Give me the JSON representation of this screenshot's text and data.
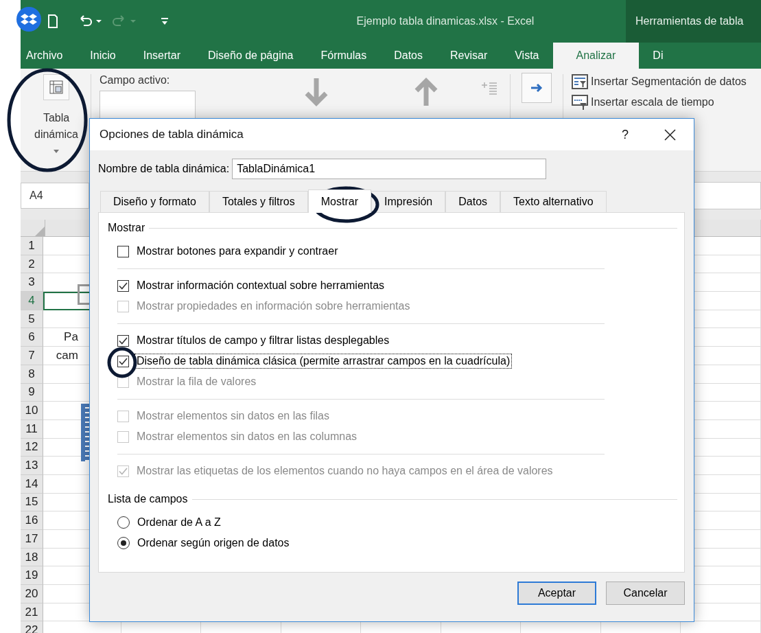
{
  "title_bar": {
    "file_title": "Ejemplo tabla dinamicas.xlsx - Excel",
    "context_title": "Herramientas de tabla"
  },
  "ribbon_tabs": [
    {
      "label": "Archivo",
      "selected": false
    },
    {
      "label": "Inicio",
      "selected": false
    },
    {
      "label": "Insertar",
      "selected": false
    },
    {
      "label": "Diseño de página",
      "selected": false
    },
    {
      "label": "Fórmulas",
      "selected": false
    },
    {
      "label": "Datos",
      "selected": false
    },
    {
      "label": "Revisar",
      "selected": false
    },
    {
      "label": "Vista",
      "selected": false
    },
    {
      "label": "Analizar",
      "selected": true
    },
    {
      "label": "Di",
      "selected": false
    }
  ],
  "ribbon": {
    "pivot_button": "Tabla dinámica",
    "active_field_label": "Campo activo:",
    "commands": [
      "Insertar Segmentación de datos",
      "Insertar escala de tiempo"
    ]
  },
  "name_box": "A4",
  "sheet": {
    "rows": [
      {
        "header": "1",
        "selected": false
      },
      {
        "header": "2",
        "selected": false
      },
      {
        "header": "3",
        "selected": false
      },
      {
        "header": "4",
        "selected": true
      },
      {
        "header": "5",
        "selected": false
      },
      {
        "header": "6",
        "selected": false,
        "cell_a": "Pa"
      },
      {
        "header": "7",
        "selected": false,
        "cell_a": "cam"
      },
      {
        "header": "8",
        "selected": false
      },
      {
        "header": "9",
        "selected": false
      },
      {
        "header": "10",
        "selected": false
      },
      {
        "header": "11",
        "selected": false
      },
      {
        "header": "12",
        "selected": false
      },
      {
        "header": "13",
        "selected": false
      },
      {
        "header": "14",
        "selected": false
      },
      {
        "header": "15",
        "selected": false
      },
      {
        "header": "16",
        "selected": false
      },
      {
        "header": "17",
        "selected": false
      },
      {
        "header": "18",
        "selected": false
      },
      {
        "header": "19",
        "selected": false
      },
      {
        "header": "20",
        "selected": false
      },
      {
        "header": "21",
        "selected": false
      },
      {
        "header": "22",
        "selected": false
      }
    ]
  },
  "dialog": {
    "title": "Opciones de tabla dinámica",
    "help": "?",
    "name_label": "Nombre de tabla dinámica:",
    "name_value": "TablaDinámica1",
    "tabs": [
      {
        "label": "Diseño y formato",
        "selected": false
      },
      {
        "label": "Totales y filtros",
        "selected": false
      },
      {
        "label": "Mostrar",
        "selected": true
      },
      {
        "label": "Impresión",
        "selected": false
      },
      {
        "label": "Datos",
        "selected": false
      },
      {
        "label": "Texto alternativo",
        "selected": false
      }
    ],
    "display_section": {
      "heading": "Mostrar",
      "groups": [
        {
          "options": [
            {
              "label": "Mostrar botones para expandir y contraer",
              "checked": false,
              "disabled": false,
              "focused": false
            }
          ]
        },
        {
          "options": [
            {
              "label": "Mostrar información contextual sobre herramientas",
              "checked": true,
              "disabled": false,
              "focused": false
            },
            {
              "label": "Mostrar propiedades en información sobre herramientas",
              "checked": false,
              "disabled": true,
              "focused": false
            }
          ]
        },
        {
          "options": [
            {
              "label": "Mostrar títulos de campo y filtrar listas desplegables",
              "checked": true,
              "disabled": false,
              "focused": false
            },
            {
              "label": "Diseño de tabla dinámica clásica (permite arrastrar campos en la cuadrícula)",
              "checked": true,
              "disabled": false,
              "focused": true
            },
            {
              "label": "Mostrar la fila de valores",
              "checked": false,
              "disabled": true,
              "focused": false
            }
          ]
        },
        {
          "options": [
            {
              "label": "Mostrar elementos sin datos en las filas",
              "checked": false,
              "disabled": true,
              "focused": false
            },
            {
              "label": "Mostrar elementos sin datos en las columnas",
              "checked": false,
              "disabled": true,
              "focused": false
            }
          ]
        },
        {
          "options": [
            {
              "label": "Mostrar las etiquetas de los elementos cuando no haya campos en el área de valores",
              "checked": true,
              "disabled": true,
              "focused": false
            }
          ]
        }
      ]
    },
    "field_list_section": {
      "heading": "Lista de campos",
      "options": [
        {
          "label": "Ordenar de A a Z",
          "selected": false
        },
        {
          "label": "Ordenar según origen de datos",
          "selected": true
        }
      ]
    },
    "buttons": [
      {
        "label": "Aceptar",
        "default": true
      },
      {
        "label": "Cancelar",
        "default": false
      }
    ]
  }
}
